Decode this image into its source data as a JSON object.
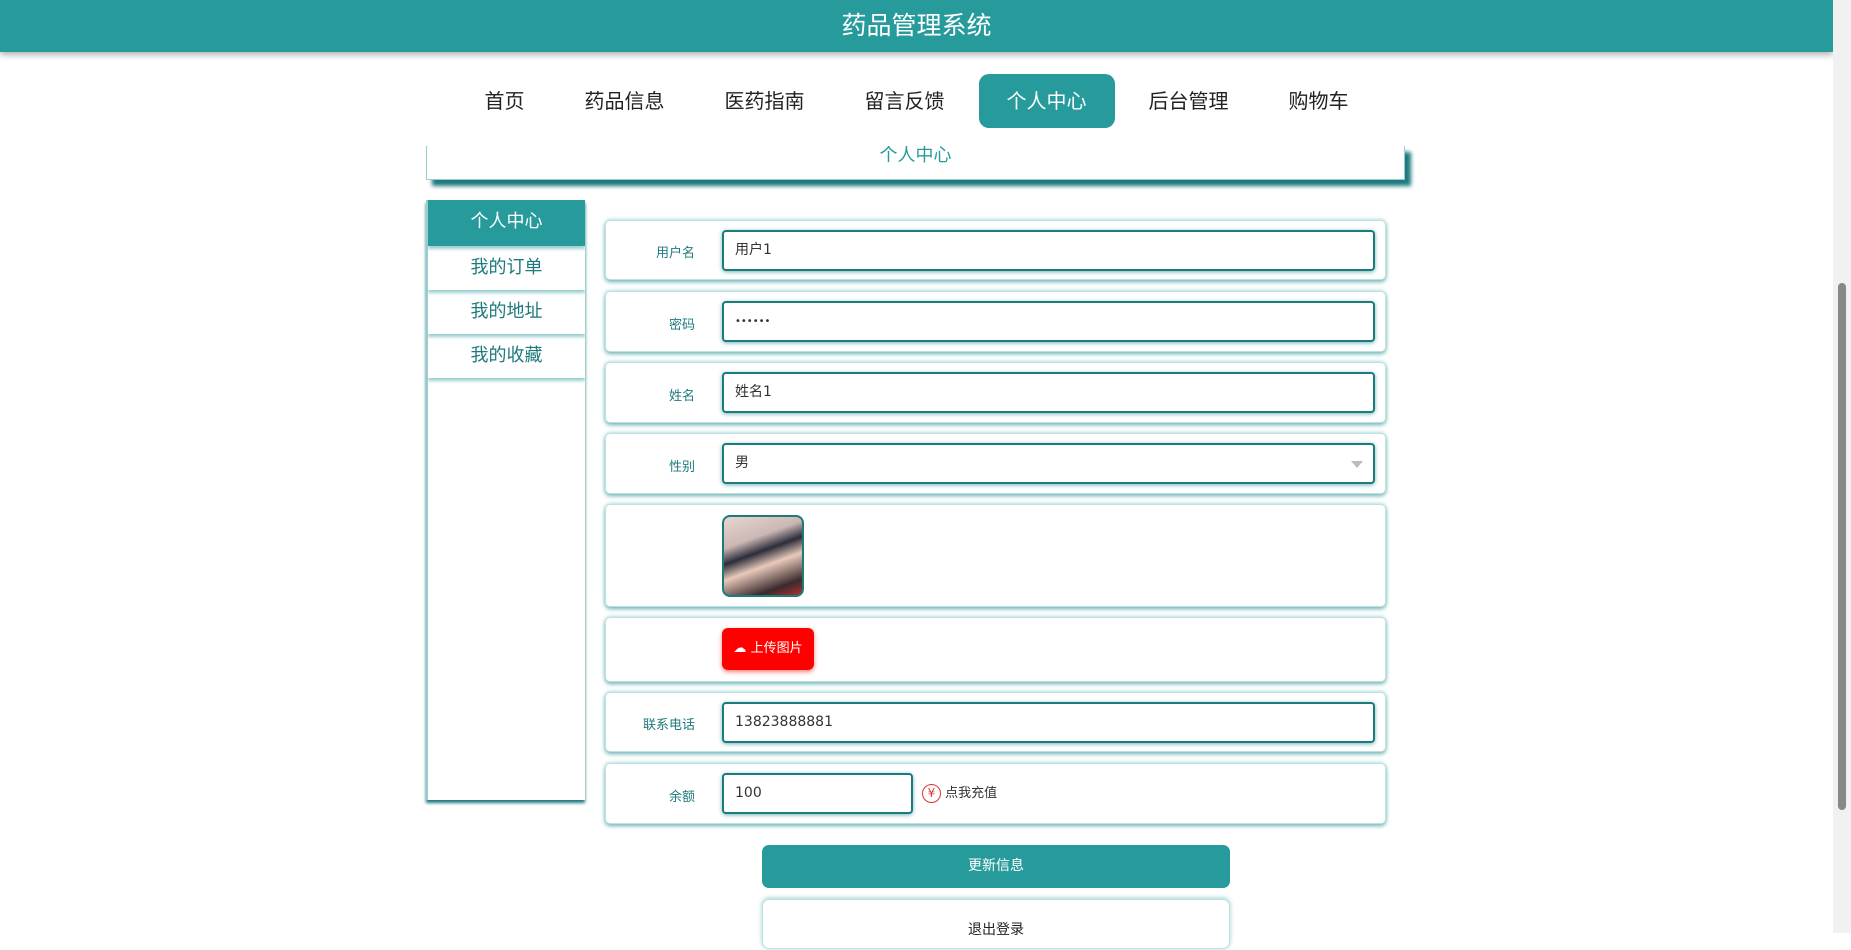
{
  "header": {
    "title": "药品管理系统"
  },
  "nav": {
    "items": [
      "首页",
      "药品信息",
      "医药指南",
      "留言反馈",
      "个人中心",
      "后台管理",
      "购物车"
    ],
    "active": "个人中心"
  },
  "banner": {
    "title": "个人中心"
  },
  "sidebar": {
    "items": [
      "个人中心",
      "我的订单",
      "我的地址",
      "我的收藏"
    ]
  },
  "form": {
    "username_label": "用户名",
    "username": "用户1",
    "password_label": "密码",
    "password": "••••••",
    "name_label": "姓名",
    "name": "姓名1",
    "gender_label": "性别",
    "gender": "男",
    "upload_label": "上传图片",
    "phone_label": "联系电话",
    "phone": "13823888881",
    "balance_label": "余额",
    "balance": "100",
    "recharge_label": "点我充值"
  },
  "buttons": {
    "update": "更新信息",
    "logout": "退出登录"
  },
  "colors": {
    "primary": "#279b9b",
    "upload": "#ff0000"
  }
}
